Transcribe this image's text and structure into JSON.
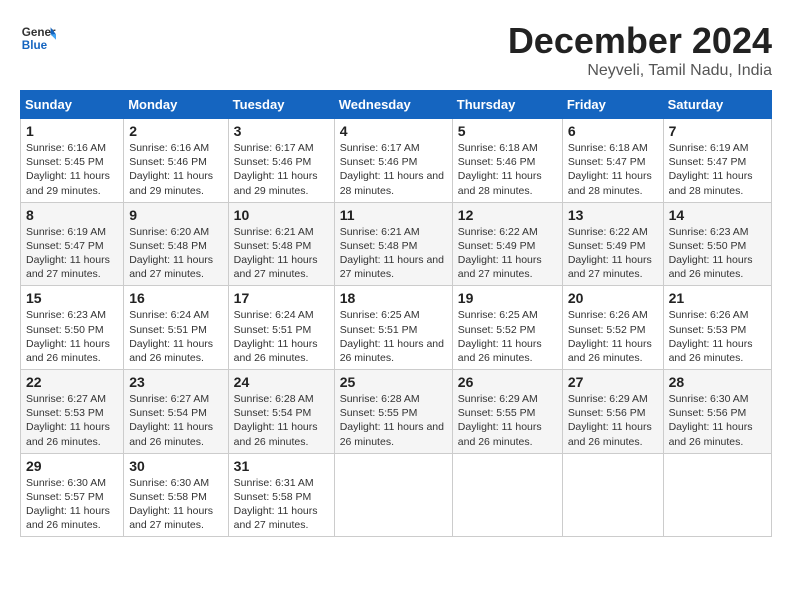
{
  "logo": {
    "text_general": "General",
    "text_blue": "Blue"
  },
  "title": {
    "month_year": "December 2024",
    "location": "Neyveli, Tamil Nadu, India"
  },
  "weekdays": [
    "Sunday",
    "Monday",
    "Tuesday",
    "Wednesday",
    "Thursday",
    "Friday",
    "Saturday"
  ],
  "weeks": [
    [
      {
        "day": "1",
        "sunrise": "6:16 AM",
        "sunset": "5:45 PM",
        "daylight": "11 hours and 29 minutes."
      },
      {
        "day": "2",
        "sunrise": "6:16 AM",
        "sunset": "5:46 PM",
        "daylight": "11 hours and 29 minutes."
      },
      {
        "day": "3",
        "sunrise": "6:17 AM",
        "sunset": "5:46 PM",
        "daylight": "11 hours and 29 minutes."
      },
      {
        "day": "4",
        "sunrise": "6:17 AM",
        "sunset": "5:46 PM",
        "daylight": "11 hours and 28 minutes."
      },
      {
        "day": "5",
        "sunrise": "6:18 AM",
        "sunset": "5:46 PM",
        "daylight": "11 hours and 28 minutes."
      },
      {
        "day": "6",
        "sunrise": "6:18 AM",
        "sunset": "5:47 PM",
        "daylight": "11 hours and 28 minutes."
      },
      {
        "day": "7",
        "sunrise": "6:19 AM",
        "sunset": "5:47 PM",
        "daylight": "11 hours and 28 minutes."
      }
    ],
    [
      {
        "day": "8",
        "sunrise": "6:19 AM",
        "sunset": "5:47 PM",
        "daylight": "11 hours and 27 minutes."
      },
      {
        "day": "9",
        "sunrise": "6:20 AM",
        "sunset": "5:48 PM",
        "daylight": "11 hours and 27 minutes."
      },
      {
        "day": "10",
        "sunrise": "6:21 AM",
        "sunset": "5:48 PM",
        "daylight": "11 hours and 27 minutes."
      },
      {
        "day": "11",
        "sunrise": "6:21 AM",
        "sunset": "5:48 PM",
        "daylight": "11 hours and 27 minutes."
      },
      {
        "day": "12",
        "sunrise": "6:22 AM",
        "sunset": "5:49 PM",
        "daylight": "11 hours and 27 minutes."
      },
      {
        "day": "13",
        "sunrise": "6:22 AM",
        "sunset": "5:49 PM",
        "daylight": "11 hours and 27 minutes."
      },
      {
        "day": "14",
        "sunrise": "6:23 AM",
        "sunset": "5:50 PM",
        "daylight": "11 hours and 26 minutes."
      }
    ],
    [
      {
        "day": "15",
        "sunrise": "6:23 AM",
        "sunset": "5:50 PM",
        "daylight": "11 hours and 26 minutes."
      },
      {
        "day": "16",
        "sunrise": "6:24 AM",
        "sunset": "5:51 PM",
        "daylight": "11 hours and 26 minutes."
      },
      {
        "day": "17",
        "sunrise": "6:24 AM",
        "sunset": "5:51 PM",
        "daylight": "11 hours and 26 minutes."
      },
      {
        "day": "18",
        "sunrise": "6:25 AM",
        "sunset": "5:51 PM",
        "daylight": "11 hours and 26 minutes."
      },
      {
        "day": "19",
        "sunrise": "6:25 AM",
        "sunset": "5:52 PM",
        "daylight": "11 hours and 26 minutes."
      },
      {
        "day": "20",
        "sunrise": "6:26 AM",
        "sunset": "5:52 PM",
        "daylight": "11 hours and 26 minutes."
      },
      {
        "day": "21",
        "sunrise": "6:26 AM",
        "sunset": "5:53 PM",
        "daylight": "11 hours and 26 minutes."
      }
    ],
    [
      {
        "day": "22",
        "sunrise": "6:27 AM",
        "sunset": "5:53 PM",
        "daylight": "11 hours and 26 minutes."
      },
      {
        "day": "23",
        "sunrise": "6:27 AM",
        "sunset": "5:54 PM",
        "daylight": "11 hours and 26 minutes."
      },
      {
        "day": "24",
        "sunrise": "6:28 AM",
        "sunset": "5:54 PM",
        "daylight": "11 hours and 26 minutes."
      },
      {
        "day": "25",
        "sunrise": "6:28 AM",
        "sunset": "5:55 PM",
        "daylight": "11 hours and 26 minutes."
      },
      {
        "day": "26",
        "sunrise": "6:29 AM",
        "sunset": "5:55 PM",
        "daylight": "11 hours and 26 minutes."
      },
      {
        "day": "27",
        "sunrise": "6:29 AM",
        "sunset": "5:56 PM",
        "daylight": "11 hours and 26 minutes."
      },
      {
        "day": "28",
        "sunrise": "6:30 AM",
        "sunset": "5:56 PM",
        "daylight": "11 hours and 26 minutes."
      }
    ],
    [
      {
        "day": "29",
        "sunrise": "6:30 AM",
        "sunset": "5:57 PM",
        "daylight": "11 hours and 26 minutes."
      },
      {
        "day": "30",
        "sunrise": "6:30 AM",
        "sunset": "5:58 PM",
        "daylight": "11 hours and 27 minutes."
      },
      {
        "day": "31",
        "sunrise": "6:31 AM",
        "sunset": "5:58 PM",
        "daylight": "11 hours and 27 minutes."
      },
      null,
      null,
      null,
      null
    ]
  ],
  "labels": {
    "sunrise": "Sunrise:",
    "sunset": "Sunset:",
    "daylight": "Daylight:"
  }
}
